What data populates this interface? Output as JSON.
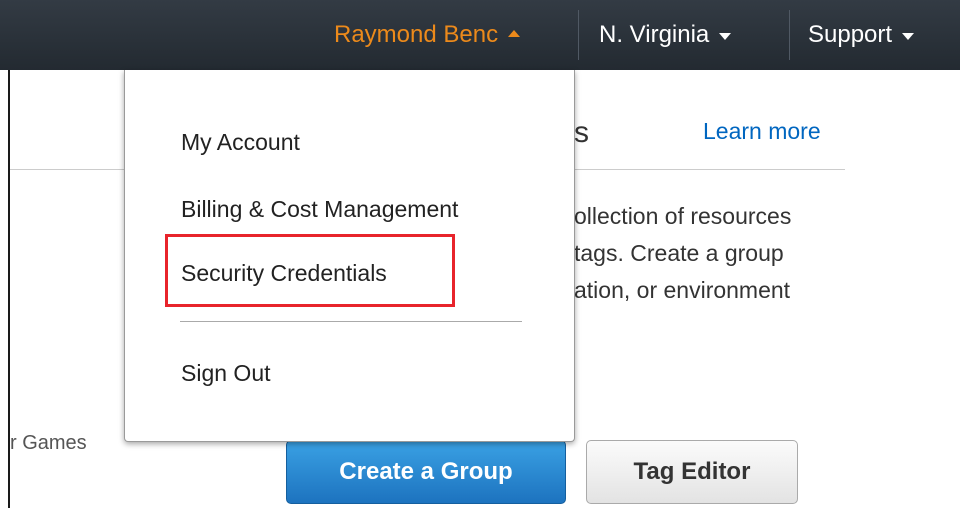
{
  "topbar": {
    "user_label": "Raymond Benc",
    "region_label": "N. Virginia",
    "support_label": "Support"
  },
  "background": {
    "heading_fragment": "s",
    "learn_more": "Learn more",
    "description_lines": [
      "ollection of resources",
      "tags. Create a group",
      "ation, or environment"
    ],
    "games_label": "r Games",
    "create_group_button": "Create a Group",
    "tag_editor_button": "Tag Editor"
  },
  "account_menu": {
    "items": [
      "My Account",
      "Billing & Cost Management",
      "Security Credentials"
    ],
    "sign_out": "Sign Out"
  },
  "colors": {
    "topbar_bg": "#232a31",
    "user_menu_accent": "#ec8a1b",
    "link_blue": "#0066c0",
    "highlight_red": "#e8242b",
    "primary_button": "#1d73bf"
  },
  "icons": {
    "user_menu": "caret-up-icon",
    "region_menu": "caret-down-icon",
    "support_menu": "caret-down-icon"
  }
}
